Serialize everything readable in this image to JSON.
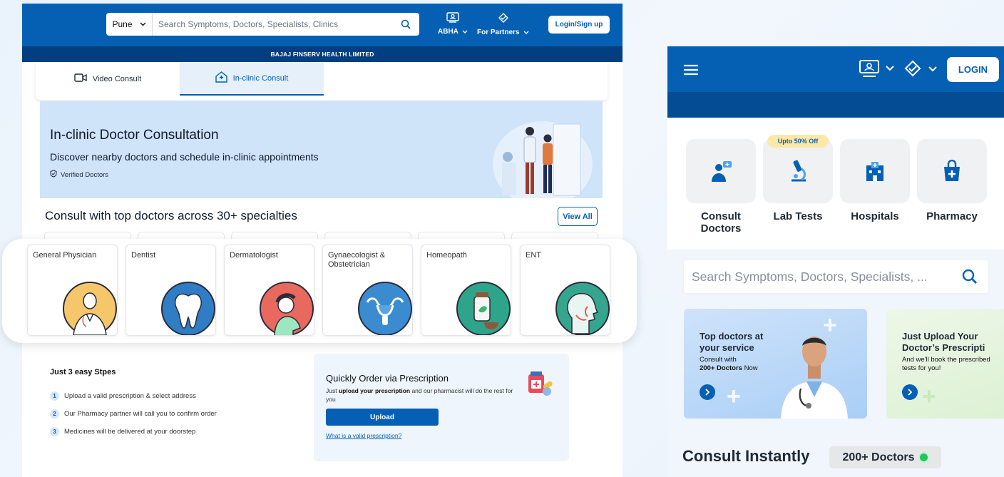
{
  "desktop": {
    "header": {
      "city": "Pune",
      "search_placeholder": "Search Symptoms, Doctors, Specialists, Clinics",
      "abha_label": "ABHA",
      "partners_label": "For Partners",
      "login_label": "Login/Sign up",
      "company_bar": "BAJAJ FINSERV HEALTH LIMITED"
    },
    "tabs": [
      {
        "label": "Video Consult",
        "icon": "video-camera-icon",
        "active": false
      },
      {
        "label": "In-clinic Consult",
        "icon": "clinic-icon",
        "active": true
      }
    ],
    "hero": {
      "title": "In-clinic Doctor Consultation",
      "subtitle": "Discover nearby doctors and schedule in-clinic appointments",
      "verified": "Verified Doctors"
    },
    "specialties": {
      "title": "Consult with top doctors across 30+ specialties",
      "view_all": "View All",
      "items": [
        {
          "name": "General Physician",
          "icon": "physician-icon"
        },
        {
          "name": "Dentist",
          "icon": "tooth-icon"
        },
        {
          "name": "Dermatologist",
          "icon": "dermatology-icon"
        },
        {
          "name": "Gynaecologist & Obstetrician",
          "icon": "uterus-icon"
        },
        {
          "name": "Homeopath",
          "icon": "medicine-jar-icon"
        },
        {
          "name": "ENT",
          "icon": "ent-head-icon"
        }
      ]
    },
    "prescription": {
      "steps_title": "Just 3 easy Stpes",
      "steps": [
        "Upload a valid prescription & select address",
        "Our Pharmacy partner will call you to confirm order",
        "Medicines will be delivered at your doorstep"
      ],
      "quick_title": "Quickly Order via Prescription",
      "quick_desc_pre": "Just ",
      "quick_desc_bold": "upload your prescription",
      "quick_desc_post": " and our pharmacist will do the rest for you",
      "upload_label": "Upload",
      "valid_link": "What is a valid prescription?"
    }
  },
  "mobile": {
    "login_label": "LOGIN",
    "services": [
      {
        "label": "Consult Doctors",
        "icon": "consult-doctor-icon",
        "badge": ""
      },
      {
        "label": "Lab Tests",
        "icon": "microscope-icon",
        "badge": "Upto 50% Off"
      },
      {
        "label": "Hospitals",
        "icon": "hospital-icon",
        "badge": ""
      },
      {
        "label": "Pharmacy",
        "icon": "pharmacy-bag-icon",
        "badge": ""
      }
    ],
    "search_placeholder": "Search Symptoms, Doctors, Specialists, ...",
    "banners": [
      {
        "title": "Top doctors at your service",
        "sub_pre": "Consult with",
        "sub_bold": "200+ Doctors",
        "sub_post": " Now"
      },
      {
        "title": "Just Upload Your Doctor’s Prescripti",
        "sub": "And we'll book the prescribed tests for you!"
      }
    ],
    "consult_title": "Consult Instantly",
    "doctors_count": "200+ Doctors"
  },
  "colors": {
    "brand_blue": "#0560b3",
    "dark_blue": "#033f80",
    "online_green": "#22c55e"
  }
}
